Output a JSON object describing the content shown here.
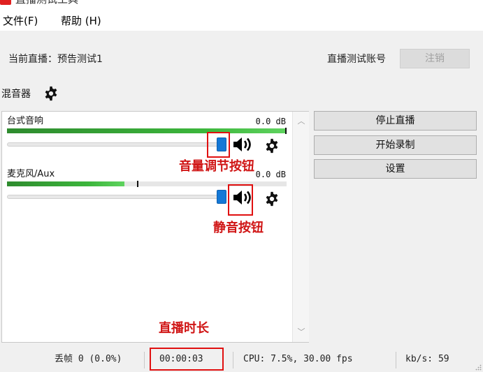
{
  "window": {
    "title": "直播测试工具"
  },
  "menu": [
    {
      "label": "文件(F)"
    },
    {
      "label": "帮助 (H)"
    }
  ],
  "header": {
    "current_stream": "当前直播：预告测试1",
    "account_label": "直播测试账号",
    "logout_label": "注销"
  },
  "mixer": {
    "title": "混音器",
    "tracks": [
      {
        "name": "台式音响",
        "db": "0.0 dB",
        "meter_level": 1.0,
        "volume": 1.0
      },
      {
        "name": "麦克风/Aux",
        "db": "0.0 dB",
        "meter_level": 0.42,
        "peak": 0.465,
        "volume": 1.0
      }
    ]
  },
  "controls": [
    {
      "label": "停止直播"
    },
    {
      "label": "开始录制"
    },
    {
      "label": "设置"
    }
  ],
  "annotations": {
    "volume": "音量调节按钮",
    "mute": "静音按钮",
    "duration": "直播时长"
  },
  "status": {
    "dropped": "丢帧 0 (0.0%)",
    "time": "00:00:03",
    "cpu": "CPU: 7.5%, 30.00 fps",
    "kbps": "kb/s: 59"
  },
  "colors": {
    "accent": "#1478d6",
    "meter": "#3cb63c",
    "annotation": "#d01515"
  }
}
